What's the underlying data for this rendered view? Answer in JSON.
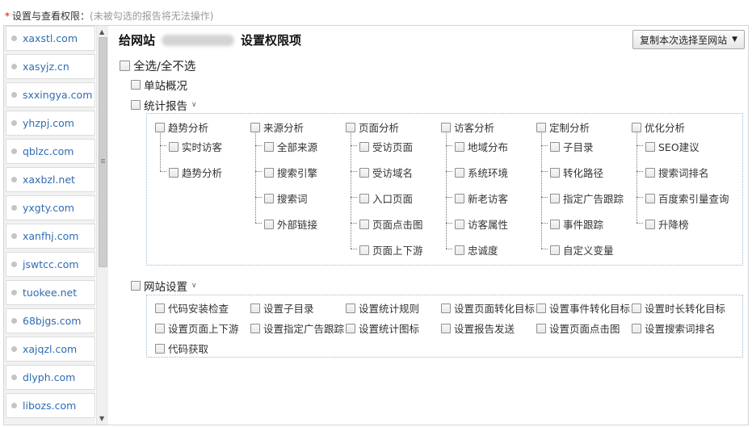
{
  "header": {
    "required_mark": "*",
    "label": "设置与查看权限：",
    "hint": "(未被勾选的报告将无法操作)"
  },
  "sites": [
    "xaxstl.com",
    "xasyjz.cn",
    "sxxingya.com",
    "yhzpj.com",
    "qblzc.com",
    "xaxbzl.net",
    "yxgty.com",
    "xanfhj.com",
    "jswtcc.com",
    "tuokee.net",
    "68bjgs.com",
    "xajqzl.com",
    "dlyph.com",
    "libozs.com"
  ],
  "panel": {
    "title_prefix": "给网站",
    "title_suffix": "设置权限项",
    "copy_button": "复制本次选择至网站",
    "select_all": "全选/全不选",
    "site_overview": "单站概况",
    "stats_report": "统计报告",
    "site_settings": "网站设置"
  },
  "report_columns": [
    {
      "label": "趋势分析",
      "items": [
        "实时访客",
        "趋势分析"
      ]
    },
    {
      "label": "来源分析",
      "items": [
        "全部来源",
        "搜索引擎",
        "搜索词",
        "外部链接"
      ]
    },
    {
      "label": "页面分析",
      "items": [
        "受访页面",
        "受访域名",
        "入口页面",
        "页面点击图",
        "页面上下游"
      ]
    },
    {
      "label": "访客分析",
      "items": [
        "地域分布",
        "系统环境",
        "新老访客",
        "访客属性",
        "忠诚度"
      ]
    },
    {
      "label": "定制分析",
      "items": [
        "子目录",
        "转化路径",
        "指定广告跟踪",
        "事件跟踪",
        "自定义变量"
      ]
    },
    {
      "label": "优化分析",
      "items": [
        "SEO建议",
        "搜索词排名",
        "百度索引量查询",
        "升降榜"
      ]
    }
  ],
  "settings_items": [
    [
      "代码安装检查",
      "设置子目录",
      "设置统计规则",
      "设置页面转化目标",
      "设置事件转化目标",
      "设置时长转化目标"
    ],
    [
      "设置页面上下游",
      "设置指定广告跟踪",
      "设置统计图标",
      "设置报告发送",
      "设置页面点击图",
      "设置搜索词排名"
    ],
    [
      "代码获取"
    ]
  ]
}
